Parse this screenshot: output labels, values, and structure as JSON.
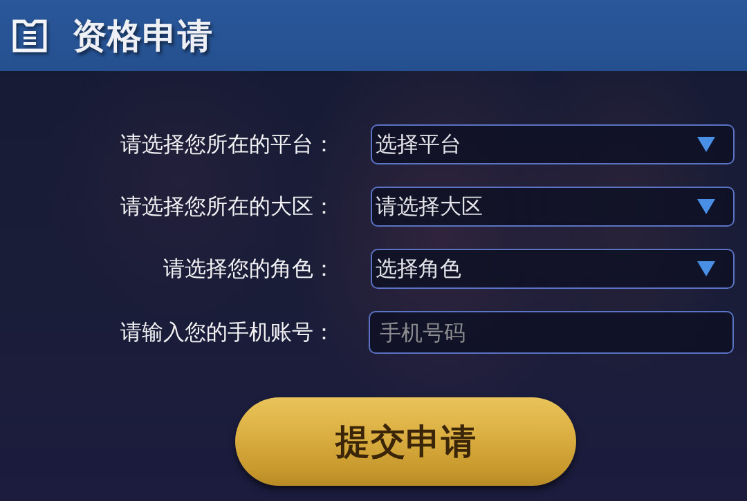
{
  "header": {
    "title": "资格申请"
  },
  "form": {
    "fields": [
      {
        "kind": "select",
        "label": "请选择您所在的平台：",
        "value": "选择平台"
      },
      {
        "kind": "select",
        "label": "请选择您所在的大区：",
        "value": "请选择大区"
      },
      {
        "kind": "select",
        "label": "请选择您的角色：",
        "value": "选择角色"
      },
      {
        "kind": "input",
        "label": "请输入您的手机账号：",
        "placeholder": "手机号码"
      }
    ]
  },
  "submit_button": {
    "label": "提交申请"
  }
}
